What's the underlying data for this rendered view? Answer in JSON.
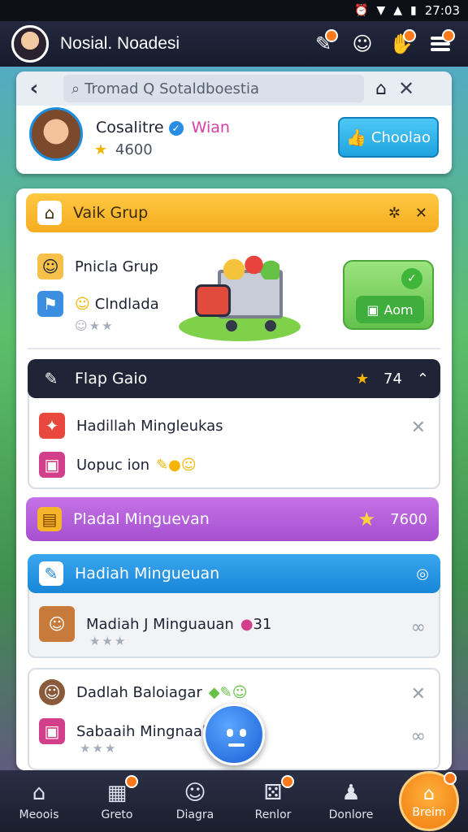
{
  "status_bar": {
    "time": "27:03"
  },
  "top_bar": {
    "title": "Nosial. Noadesi",
    "buttons": [
      {
        "icon": "tools-icon"
      },
      {
        "icon": "character-icon"
      },
      {
        "icon": "hand-icon"
      },
      {
        "icon": "menu-icon"
      }
    ]
  },
  "search_bar": {
    "text": "Tromad Q Sotaldboestia"
  },
  "profile": {
    "name": "Cosalitre",
    "tag": "Wian",
    "points": "4600",
    "choose_label": "Choolao"
  },
  "group_section": {
    "title": "Vaik Grup",
    "rows": [
      {
        "label": "Pnicla Grup"
      },
      {
        "label": "Clndlada"
      }
    ],
    "green_button_label": "Aom"
  },
  "flap_section": {
    "title": "Flap Gaio",
    "star_count": "74",
    "rows": [
      {
        "label": "Hadillah Mingleukas"
      },
      {
        "label": "Uopuc ion"
      }
    ]
  },
  "purple_section": {
    "title": "Pladal Minguevan",
    "star_count": "7600"
  },
  "blue_section": {
    "title": "Hadiah Mingueuan",
    "row_label": "Madiah J Minguauan",
    "row_count": "31"
  },
  "bottom_section": {
    "rows": [
      {
        "label": "Dadlah Baloiagar"
      },
      {
        "label": "Sabaaih Mingnaaka"
      }
    ]
  },
  "bottom_nav": {
    "items": [
      {
        "label": "Meoois",
        "icon": "home-icon"
      },
      {
        "label": "Greto",
        "icon": "shop-icon"
      },
      {
        "label": "Diagra",
        "icon": "character-icon"
      },
      {
        "label": "Renlor",
        "icon": "dice-icon"
      },
      {
        "label": "Donlore",
        "icon": "person-icon"
      },
      {
        "label": "Breim",
        "icon": "house-icon"
      }
    ]
  }
}
